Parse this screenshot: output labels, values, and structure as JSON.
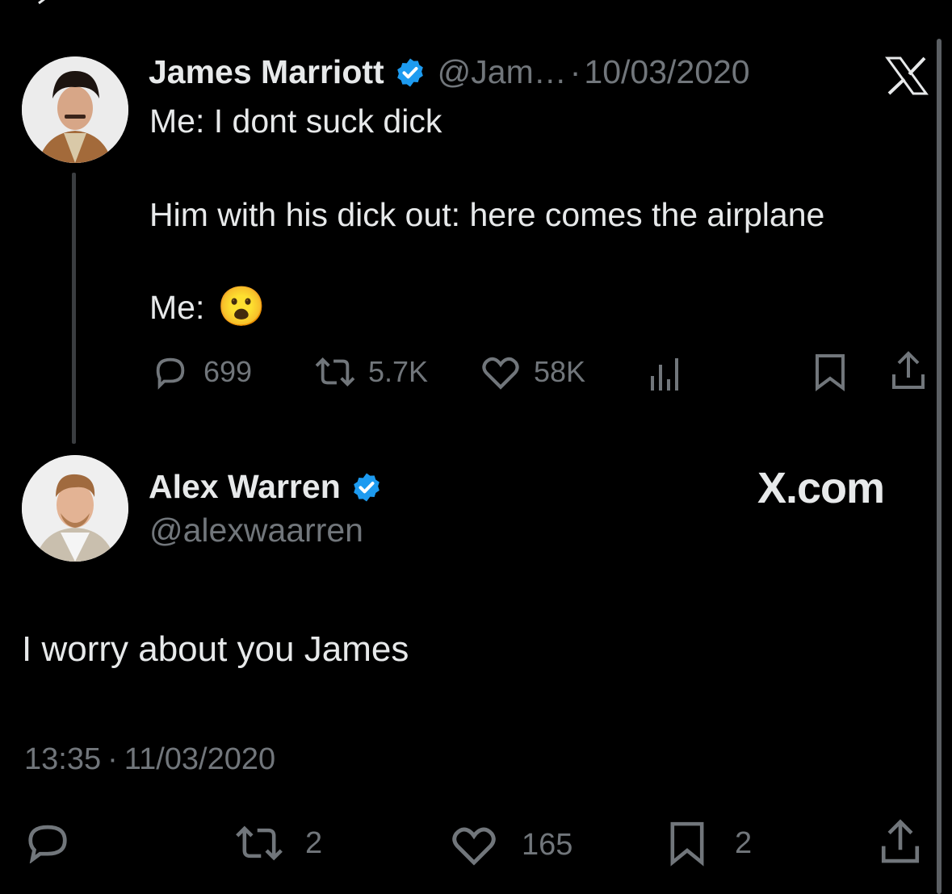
{
  "tweet": {
    "author_name": "James Marriott",
    "author_handle": "@Jam…",
    "separator": "·",
    "date": "10/03/2020",
    "line1": "Me: I dont suck dick",
    "line2": "Him with his dick out: here comes the airplane",
    "line3": "Me:",
    "emoji": "😮",
    "replies": "699",
    "reposts": "5.7K",
    "likes": "58K",
    "verified_color": "#1d9bf0",
    "source_logo": "X"
  },
  "reply": {
    "author_name": "Alex Warren",
    "author_handle": "@alexwaarren",
    "brand": "X.com",
    "text": "I worry about you James",
    "time": "13:35",
    "separator": "·",
    "date": "11/03/2020",
    "reposts": "2",
    "likes": "165",
    "bookmarks": "2"
  },
  "icons": [
    "reply-icon",
    "repost-icon",
    "like-icon",
    "views-icon",
    "bookmark-icon",
    "share-icon",
    "verified-badge-icon",
    "x-logo-icon"
  ]
}
